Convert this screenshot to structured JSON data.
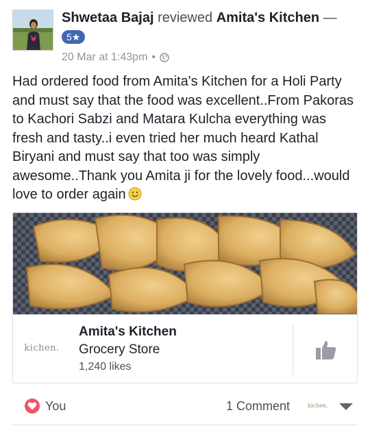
{
  "post": {
    "author": "Shwetaa Bajaj",
    "action": "reviewed",
    "page": "Amita's Kitchen",
    "dash": "—",
    "rating": "5★",
    "timestamp": "20 Mar at 1:43pm",
    "separator": "•",
    "privacy_icon": "globe-icon",
    "text": "Had ordered food from Amita's Kitchen for a Holi Party and must say that the food was excellent..From Pakoras to Kachori Sabzi and Matara Kulcha everything was fresh and tasty..i even tried her much heard Kathal Biryani and must say that too was simply awesome..Thank you Amita ji for the lovely food...would love to order again"
  },
  "card": {
    "page_name": "Amita's Kitchen",
    "category": "Grocery Store",
    "likes": "1,240 likes",
    "logo_text": "kichen."
  },
  "footer": {
    "reactor": "You",
    "comments": "1 Comment",
    "mini_logo": "kichen."
  },
  "colors": {
    "rating_badge": "#4267b2",
    "heart": "#f25268",
    "muted": "#90949c"
  }
}
